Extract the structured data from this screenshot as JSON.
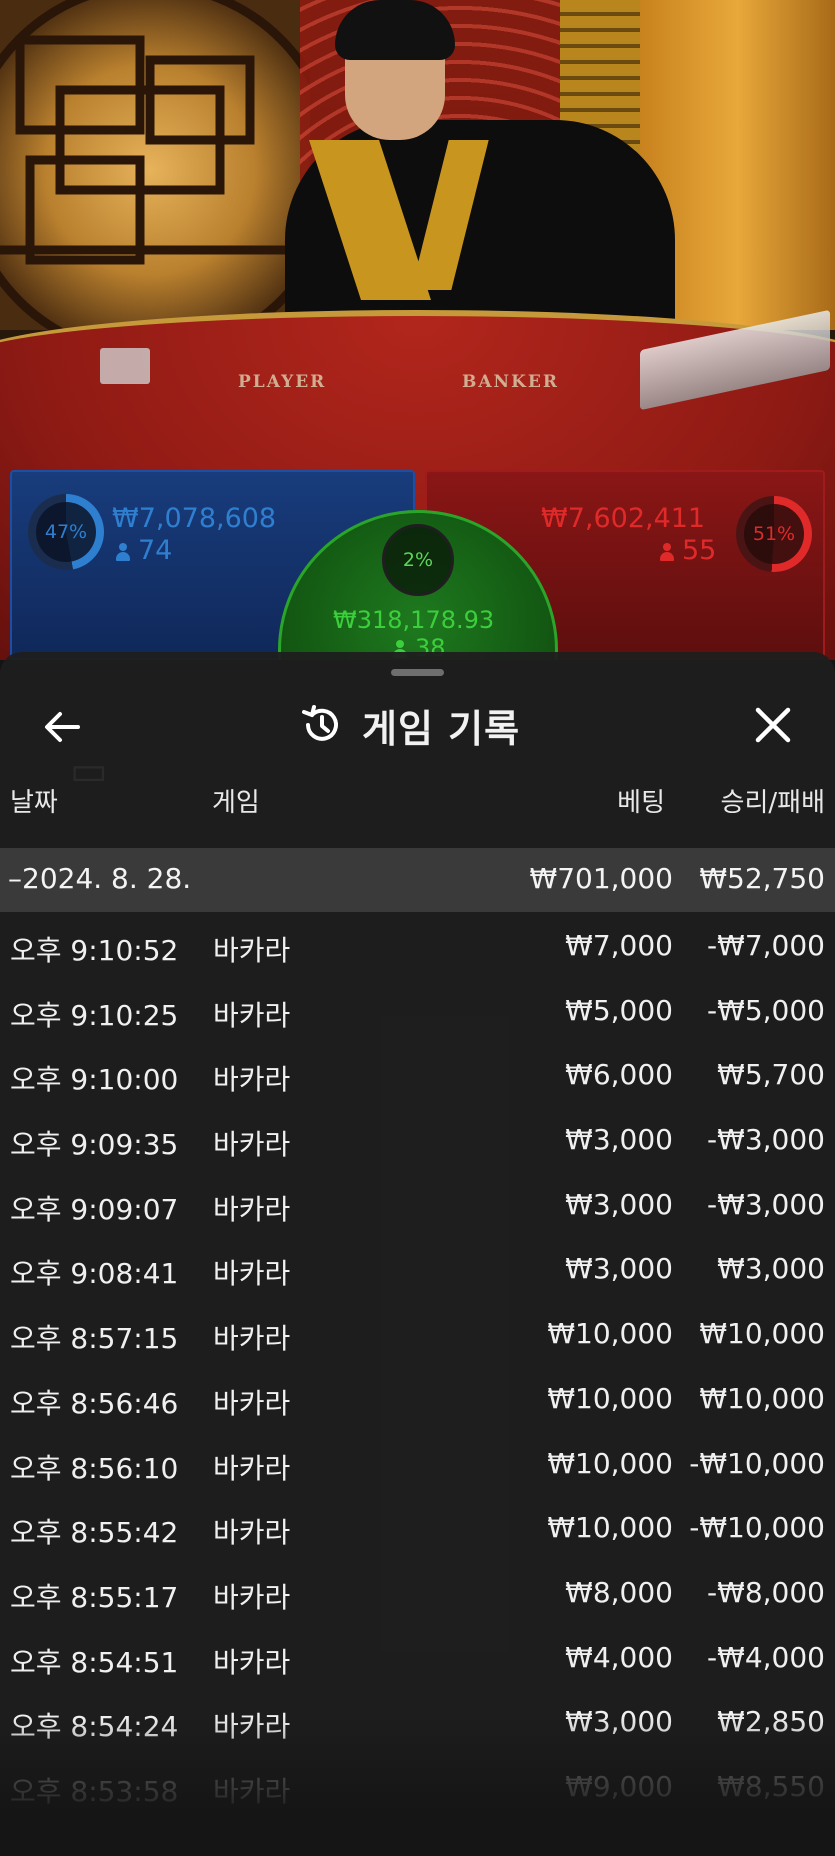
{
  "stream": {
    "table_player_label": "PLAYER",
    "table_banker_label": "BANKER",
    "player": {
      "percent": "47%",
      "amount": "₩7,078,608",
      "count": "74",
      "color": "#2f7fd1"
    },
    "banker": {
      "percent": "51%",
      "amount": "₩7,602,411",
      "count": "55",
      "color": "#e02a2a"
    },
    "tie": {
      "percent": "2%",
      "amount": "₩318,178.93",
      "count": "38",
      "color": "#3ccf3c"
    }
  },
  "sheet": {
    "title": "게임 기록",
    "history_icon": "history-icon",
    "back_icon": "arrow-left-icon",
    "close_icon": "close-icon",
    "columns": {
      "date": "날짜",
      "game": "게임",
      "bet": "베팅",
      "result": "승리/패배"
    },
    "group": {
      "date": "–2024. 8. 28.",
      "bet_total": "₩701,000",
      "result_total": "₩52,750"
    },
    "rows": [
      {
        "time": "오후 9:10:52",
        "game": "바카라",
        "bet": "₩7,000",
        "result": "-₩7,000"
      },
      {
        "time": "오후 9:10:25",
        "game": "바카라",
        "bet": "₩5,000",
        "result": "-₩5,000"
      },
      {
        "time": "오후 9:10:00",
        "game": "바카라",
        "bet": "₩6,000",
        "result": "₩5,700"
      },
      {
        "time": "오후 9:09:35",
        "game": "바카라",
        "bet": "₩3,000",
        "result": "-₩3,000"
      },
      {
        "time": "오후 9:09:07",
        "game": "바카라",
        "bet": "₩3,000",
        "result": "-₩3,000"
      },
      {
        "time": "오후 9:08:41",
        "game": "바카라",
        "bet": "₩3,000",
        "result": "₩3,000"
      },
      {
        "time": "오후 8:57:15",
        "game": "바카라",
        "bet": "₩10,000",
        "result": "₩10,000"
      },
      {
        "time": "오후 8:56:46",
        "game": "바카라",
        "bet": "₩10,000",
        "result": "₩10,000"
      },
      {
        "time": "오후 8:56:10",
        "game": "바카라",
        "bet": "₩10,000",
        "result": "-₩10,000"
      },
      {
        "time": "오후 8:55:42",
        "game": "바카라",
        "bet": "₩10,000",
        "result": "-₩10,000"
      },
      {
        "time": "오후 8:55:17",
        "game": "바카라",
        "bet": "₩8,000",
        "result": "-₩8,000"
      },
      {
        "time": "오후 8:54:51",
        "game": "바카라",
        "bet": "₩4,000",
        "result": "-₩4,000"
      },
      {
        "time": "오후 8:54:24",
        "game": "바카라",
        "bet": "₩3,000",
        "result": "₩2,850"
      },
      {
        "time": "오후 8:53:58",
        "game": "바카라",
        "bet": "₩9,000",
        "result": "₩8,550"
      }
    ]
  }
}
